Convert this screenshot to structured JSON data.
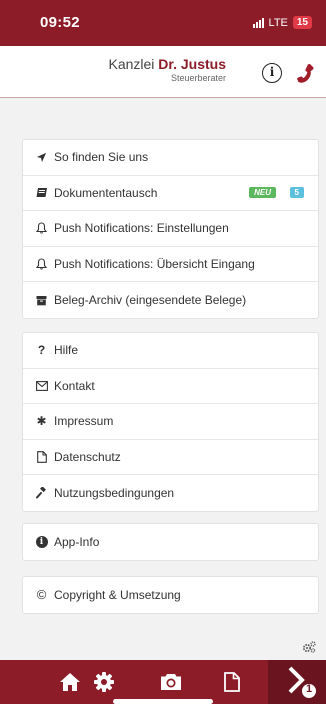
{
  "status": {
    "time": "09:52",
    "network": "LTE",
    "battery": "15"
  },
  "header": {
    "logo_prefix": "Kanzlei ",
    "logo_name": "Dr. Justus",
    "logo_sub": "Steuerberater",
    "info_glyph": "i"
  },
  "menu": {
    "group1": [
      {
        "label": "So finden Sie uns",
        "icon": "location-arrow-icon"
      },
      {
        "label": "Dokumententausch",
        "icon": "book-icon",
        "badge_new": "NEU",
        "badge_count": "5"
      },
      {
        "label": "Push Notifications: Einstellungen",
        "icon": "bell-icon"
      },
      {
        "label": "Push Notifications: Übersicht Eingang",
        "icon": "bell-icon"
      },
      {
        "label": "Beleg-Archiv (eingesendete Belege)",
        "icon": "archive-icon"
      }
    ],
    "group2": [
      {
        "label": "Hilfe",
        "icon": "question-icon",
        "glyph": "?"
      },
      {
        "label": "Kontakt",
        "icon": "envelope-icon"
      },
      {
        "label": "Impressum",
        "icon": "asterisk-icon",
        "glyph": "✱"
      },
      {
        "label": "Datenschutz",
        "icon": "file-icon"
      },
      {
        "label": "Nutzungsbedingungen",
        "icon": "gavel-icon"
      }
    ],
    "group3": [
      {
        "label": "App-Info",
        "icon": "info-circle-icon",
        "glyph": "i"
      }
    ],
    "group4": [
      {
        "label": "Copyright & Umsetzung",
        "icon": "copyright-icon",
        "glyph": "©"
      }
    ]
  },
  "tabbar": {
    "items": [
      "home-icon",
      "settings-icon",
      "camera-icon",
      "document-icon",
      "next-icon"
    ],
    "next_badge": "1"
  },
  "colors": {
    "brand": "#8b1c28",
    "badge_new": "#5cb85c",
    "badge_count": "#5bc0de"
  }
}
